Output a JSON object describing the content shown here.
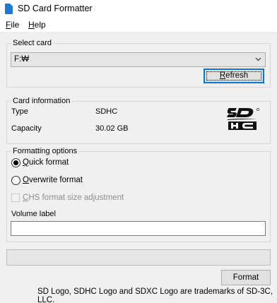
{
  "window": {
    "title": "SD Card Formatter"
  },
  "menu": {
    "file": {
      "accel": "F",
      "rest": "ile"
    },
    "help": {
      "accel": "H",
      "rest": "elp"
    }
  },
  "select_card": {
    "group_label": "Select card",
    "drive_value": "F:₩",
    "refresh": {
      "accel": "R",
      "rest": "efresh"
    }
  },
  "card_info": {
    "group_label": "Card information",
    "type_label": "Type",
    "type_value": "SDHC",
    "capacity_label": "Capacity",
    "capacity_value": "30.02 GB",
    "logo_icon": "sdhc-logo-icon"
  },
  "formatting": {
    "group_label": "Formatting options",
    "quick": {
      "accel": "Q",
      "rest": "uick format",
      "checked": true
    },
    "overwrite": {
      "accel": "O",
      "rest": "verwrite format",
      "checked": false
    },
    "chs": {
      "accel": "C",
      "rest": "HS format size adjustment",
      "enabled": false,
      "checked": false
    },
    "volume_label_caption": "Volume label",
    "volume_label_value": ""
  },
  "progress": {
    "fraction": 0
  },
  "actions": {
    "format_label": "Format"
  },
  "footer": {
    "trademark": "SD Logo, SDHC Logo and SDXC Logo are trademarks of SD-3C, LLC."
  },
  "colors": {
    "focus_border": "#0078d7",
    "progress_fill": "#06b025",
    "window_bg": "#f0f0f0"
  }
}
